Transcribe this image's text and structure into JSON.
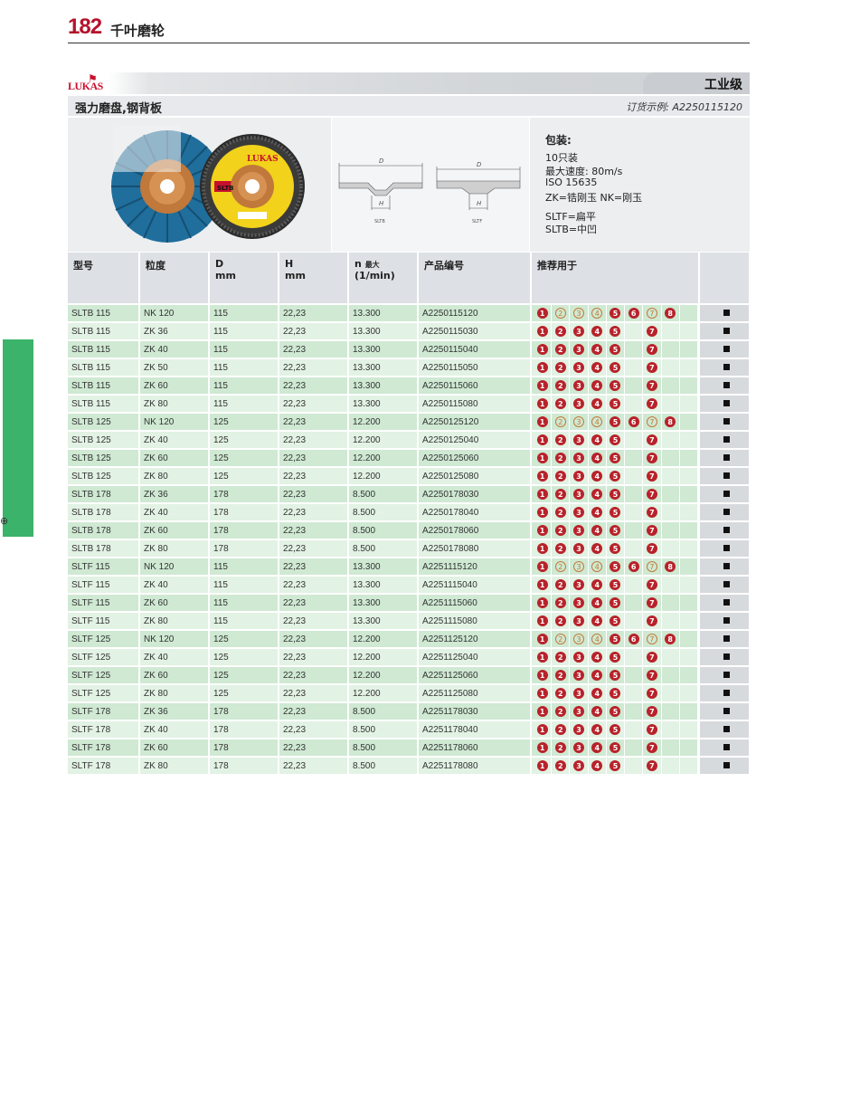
{
  "header": {
    "page_number": "182",
    "chapter": "千叶磨轮"
  },
  "band": {
    "logo": "LUKAS",
    "grade": "工业级"
  },
  "product": {
    "title": "强力磨盘,钢背板",
    "order_example": "订货示例: A2250115120"
  },
  "package": {
    "heading": "包装:",
    "lines": [
      "10只装",
      "最大速度: 80m/s",
      "ISO  15635",
      "ZK=锆刚玉   NK=刚玉",
      "SLTF=扁平",
      "SLTB=中凹"
    ]
  },
  "disc_label": {
    "brand": "LUKAS",
    "type": "SLTB"
  },
  "drawing": {
    "d_label": "D",
    "h_label": "H",
    "left_caption": "SLTB",
    "right_caption": "SLTF"
  },
  "columns": {
    "model": "型号",
    "grit": "粒度",
    "d": "D",
    "d_unit": "mm",
    "h": "H",
    "h_unit": "mm",
    "n": "n",
    "n_sub": "最大",
    "n_unit": "(1/min)",
    "code": "产品编号",
    "use": "推荐用于"
  },
  "use_symbols": [
    "1",
    "2",
    "3",
    "4",
    "5",
    "6",
    "7",
    "8"
  ],
  "rows": [
    {
      "model": "SLTB 115",
      "grit": "NK 120",
      "d": "115",
      "h": "22,23",
      "n": "13.300",
      "code": "A2250115120",
      "use": "foooffof"
    },
    {
      "model": "SLTB 115",
      "grit": "ZK 36",
      "d": "115",
      "h": "22,23",
      "n": "13.300",
      "code": "A2250115030",
      "use": "fffff-f-"
    },
    {
      "model": "SLTB 115",
      "grit": "ZK 40",
      "d": "115",
      "h": "22,23",
      "n": "13.300",
      "code": "A2250115040",
      "use": "fffff-f-"
    },
    {
      "model": "SLTB 115",
      "grit": "ZK 50",
      "d": "115",
      "h": "22,23",
      "n": "13.300",
      "code": "A2250115050",
      "use": "fffff-f-"
    },
    {
      "model": "SLTB 115",
      "grit": "ZK 60",
      "d": "115",
      "h": "22,23",
      "n": "13.300",
      "code": "A2250115060",
      "use": "fffff-f-"
    },
    {
      "model": "SLTB 115",
      "grit": "ZK 80",
      "d": "115",
      "h": "22,23",
      "n": "13.300",
      "code": "A2250115080",
      "use": "fffff-f-"
    },
    {
      "model": "SLTB 125",
      "grit": "NK 120",
      "d": "125",
      "h": "22,23",
      "n": "12.200",
      "code": "A2250125120",
      "use": "foooffof"
    },
    {
      "model": "SLTB 125",
      "grit": "ZK 40",
      "d": "125",
      "h": "22,23",
      "n": "12.200",
      "code": "A2250125040",
      "use": "fffff-f-"
    },
    {
      "model": "SLTB 125",
      "grit": "ZK 60",
      "d": "125",
      "h": "22,23",
      "n": "12.200",
      "code": "A2250125060",
      "use": "fffff-f-"
    },
    {
      "model": "SLTB 125",
      "grit": "ZK 80",
      "d": "125",
      "h": "22,23",
      "n": "12.200",
      "code": "A2250125080",
      "use": "fffff-f-"
    },
    {
      "model": "SLTB 178",
      "grit": "ZK 36",
      "d": "178",
      "h": "22,23",
      "n": "8.500",
      "code": "A2250178030",
      "use": "fffff-f-"
    },
    {
      "model": "SLTB 178",
      "grit": "ZK 40",
      "d": "178",
      "h": "22,23",
      "n": "8.500",
      "code": "A2250178040",
      "use": "fffff-f-"
    },
    {
      "model": "SLTB 178",
      "grit": "ZK 60",
      "d": "178",
      "h": "22,23",
      "n": "8.500",
      "code": "A2250178060",
      "use": "fffff-f-"
    },
    {
      "model": "SLTB 178",
      "grit": "ZK 80",
      "d": "178",
      "h": "22,23",
      "n": "8.500",
      "code": "A2250178080",
      "use": "fffff-f-"
    },
    {
      "model": "SLTF 115",
      "grit": "NK 120",
      "d": "115",
      "h": "22,23",
      "n": "13.300",
      "code": "A2251115120",
      "use": "foooffof"
    },
    {
      "model": "SLTF 115",
      "grit": "ZK 40",
      "d": "115",
      "h": "22,23",
      "n": "13.300",
      "code": "A2251115040",
      "use": "fffff-f-"
    },
    {
      "model": "SLTF 115",
      "grit": "ZK 60",
      "d": "115",
      "h": "22,23",
      "n": "13.300",
      "code": "A2251115060",
      "use": "fffff-f-"
    },
    {
      "model": "SLTF 115",
      "grit": "ZK 80",
      "d": "115",
      "h": "22,23",
      "n": "13.300",
      "code": "A2251115080",
      "use": "fffff-f-"
    },
    {
      "model": "SLTF 125",
      "grit": "NK 120",
      "d": "125",
      "h": "22,23",
      "n": "12.200",
      "code": "A2251125120",
      "use": "foooffof"
    },
    {
      "model": "SLTF 125",
      "grit": "ZK 40",
      "d": "125",
      "h": "22,23",
      "n": "12.200",
      "code": "A2251125040",
      "use": "fffff-f-"
    },
    {
      "model": "SLTF 125",
      "grit": "ZK 60",
      "d": "125",
      "h": "22,23",
      "n": "12.200",
      "code": "A2251125060",
      "use": "fffff-f-"
    },
    {
      "model": "SLTF 125",
      "grit": "ZK 80",
      "d": "125",
      "h": "22,23",
      "n": "12.200",
      "code": "A2251125080",
      "use": "fffff-f-"
    },
    {
      "model": "SLTF 178",
      "grit": "ZK 36",
      "d": "178",
      "h": "22,23",
      "n": "8.500",
      "code": "A2251178030",
      "use": "fffff-f-"
    },
    {
      "model": "SLTF 178",
      "grit": "ZK 40",
      "d": "178",
      "h": "22,23",
      "n": "8.500",
      "code": "A2251178040",
      "use": "fffff-f-"
    },
    {
      "model": "SLTF 178",
      "grit": "ZK 60",
      "d": "178",
      "h": "22,23",
      "n": "8.500",
      "code": "A2251178060",
      "use": "fffff-f-"
    },
    {
      "model": "SLTF 178",
      "grit": "ZK 80",
      "d": "178",
      "h": "22,23",
      "n": "8.500",
      "code": "A2251178080",
      "use": "fffff-f-"
    }
  ],
  "colors": {
    "accent_red": "#b8222a",
    "side_tab_green": "#3bb36a",
    "row_green": "#cfe9d3"
  }
}
